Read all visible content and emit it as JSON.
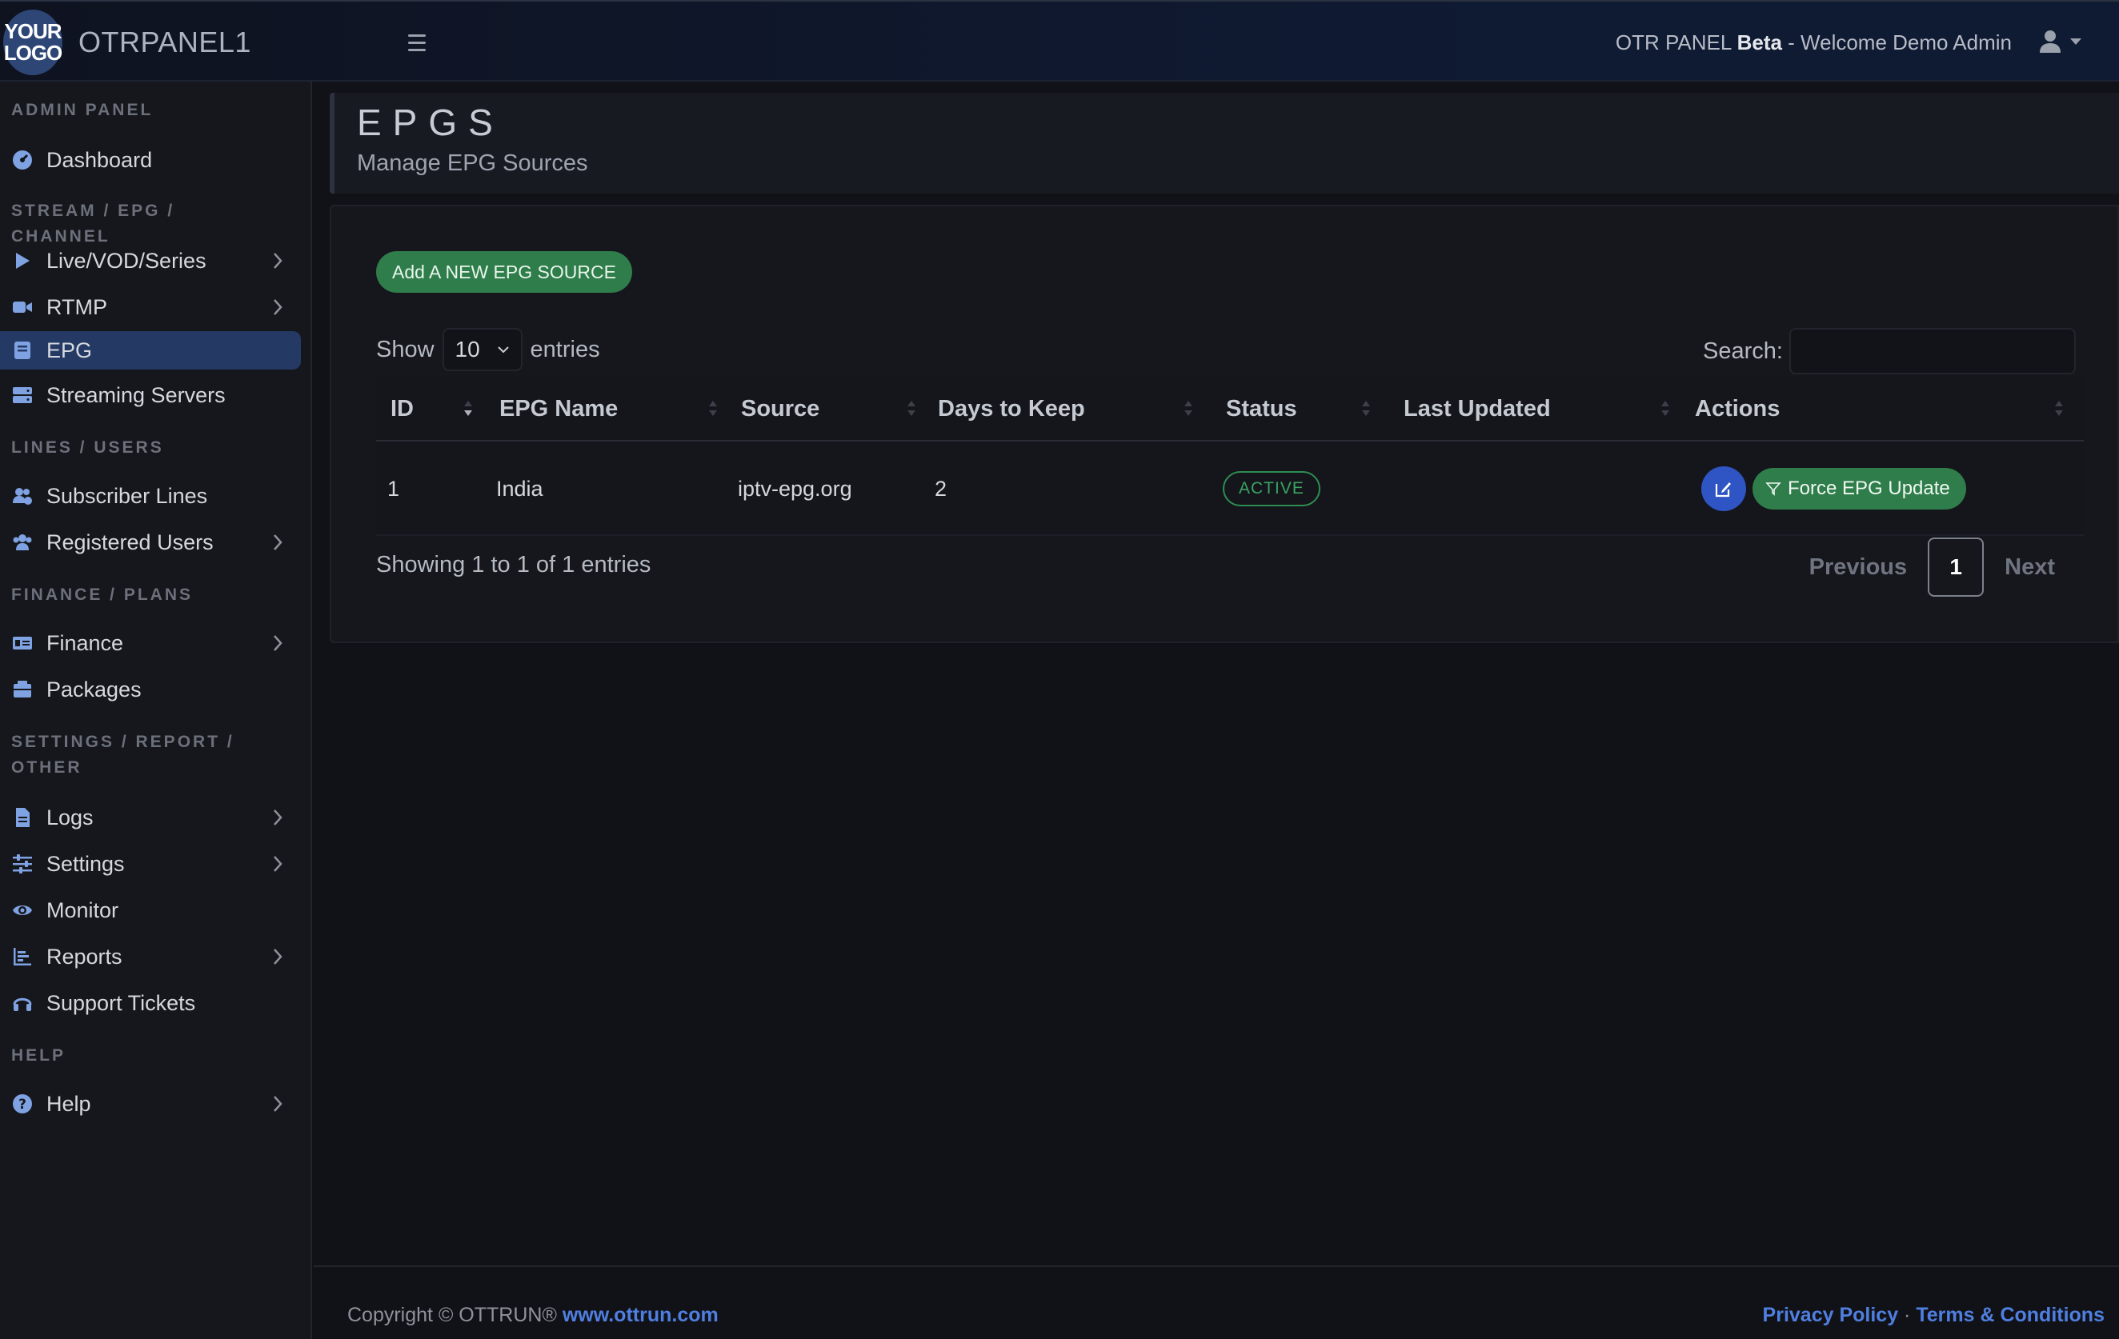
{
  "header": {
    "logo_line1": "YOUR",
    "logo_line2": "LOGO",
    "brand": "OTRPANEL1",
    "welcome_prefix": "OTR PANEL ",
    "welcome_beta": "Beta",
    "welcome_suffix": " - Welcome Demo Admin"
  },
  "sidebar": {
    "headings": {
      "admin": "ADMIN PANEL",
      "stream": "STREAM / EPG / CHANNEL",
      "lines": "LINES / USERS",
      "finance": "FINANCE / PLANS",
      "settings_line1": "SETTINGS / REPORT /",
      "settings_line2": "OTHER",
      "help": "HELP"
    },
    "items": {
      "dashboard": "Dashboard",
      "live": "Live/VOD/Series",
      "rtmp": "RTMP",
      "epg": "EPG",
      "streaming": "Streaming Servers",
      "subscriber": "Subscriber Lines",
      "registered": "Registered Users",
      "finance": "Finance",
      "packages": "Packages",
      "logs": "Logs",
      "settings": "Settings",
      "monitor": "Monitor",
      "reports": "Reports",
      "support": "Support Tickets",
      "help": "Help"
    }
  },
  "page": {
    "title": "EPGS",
    "subtitle": "Manage EPG Sources"
  },
  "card": {
    "add_button": "Add A NEW EPG SOURCE",
    "show_label": "Show",
    "entries_value": "10",
    "entries_label": "entries",
    "search_label": "Search:",
    "search_value": ""
  },
  "table": {
    "headers": {
      "id": "ID",
      "name": "EPG Name",
      "source": "Source",
      "days": "Days to Keep",
      "status": "Status",
      "updated": "Last Updated",
      "actions": "Actions"
    },
    "rows": [
      {
        "id": "1",
        "name": "India",
        "source": "iptv-epg.org",
        "days": "2",
        "status": "ACTIVE",
        "updated": "",
        "force_label": "Force EPG Update"
      }
    ]
  },
  "pagination": {
    "info": "Showing 1 to 1 of 1 entries",
    "previous": "Previous",
    "current": "1",
    "next": "Next"
  },
  "footer": {
    "copyright": "Copyright © OTTRUN® ",
    "site": "www.ottrun.com",
    "privacy": "Privacy Policy",
    "separator": " · ",
    "terms": "Terms & Conditions"
  },
  "colors": {
    "accent_blue": "#243a64",
    "success_green": "#2f7d4a",
    "link_blue": "#4f7fe0"
  }
}
